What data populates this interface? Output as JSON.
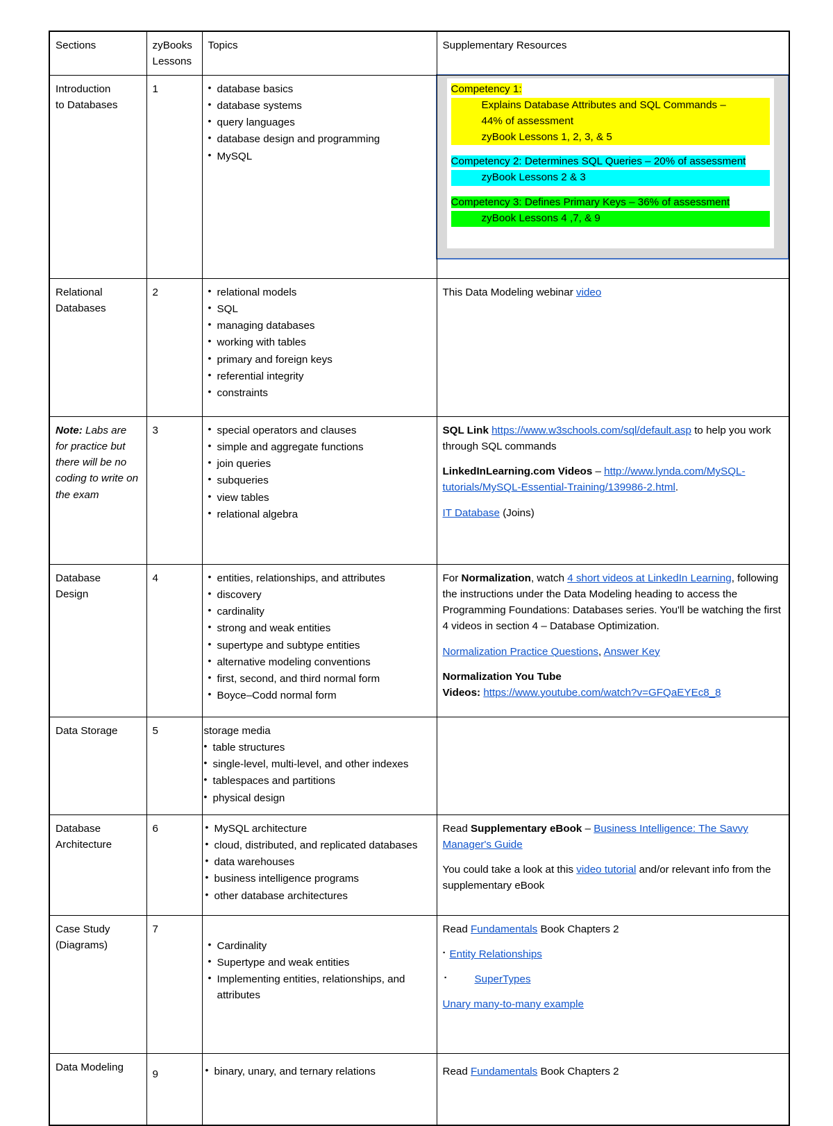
{
  "table": {
    "headers": {
      "sections": "Sections",
      "lessons_line1": "zyBooks",
      "lessons_line2": "Lessons",
      "topics": "Topics",
      "resources": "Supplementary Resources"
    },
    "rows": [
      {
        "section_line1": "Introduction",
        "section_line2": "to Databases",
        "lesson": "1",
        "topics": [
          "database basics",
          "database systems",
          "query languages",
          "database design and programming",
          "MySQL"
        ],
        "competency_box": {
          "c1_title": "Competency 1:",
          "c1_l1": "Explains Database Attributes and SQL Commands –",
          "c1_l2": "44% of assessment",
          "c1_l3": "zyBook Lessons 1, 2, 3, & 5",
          "c2_l1": "Competency 2: Determines SQL Queries – 20% of assessment",
          "c2_l2": "zyBook Lessons 2 & 3",
          "c3_l1": "Competency 3: Defines Primary Keys – 36% of assessment",
          "c3_l2": "zyBook Lessons 4 ,7, & 9",
          "colors": {
            "c1": "#ffff00",
            "c2": "#00ffff",
            "c3": "#00ff00",
            "border": "#4472c4",
            "fill": "#d9d9d9"
          }
        }
      },
      {
        "section_line1": "Relational",
        "section_line2": "Databases",
        "lesson": "2",
        "topics": [
          "relational models",
          "SQL",
          "managing databases",
          "working with tables",
          "primary and foreign keys",
          "referential integrity",
          "constraints"
        ],
        "resources": {
          "p1_pre": "This Data Modeling webinar ",
          "p1_link": "video"
        }
      },
      {
        "note_bold": "Note:",
        "note_text": " Labs are for practice but there will be no coding to write on the exam",
        "lesson": "3",
        "topics": [
          "special operators and clauses",
          "simple and aggregate functions",
          "join queries",
          "subqueries",
          "view tables",
          "relational algebra"
        ],
        "resources": {
          "p1_pre": " SQL Link ",
          "p1_link": "https://www.w3schools.com/sql/default.asp",
          "p1_post": " to help you work through SQL commands",
          "p2_bold": "LinkedInLearning.com Videos",
          "p2_dash": " – ",
          "p2_link": "http://www.lynda.com/MySQL-tutorials/MySQL-Essential-Training/139986-2.html",
          "p2_post": ".",
          "p3_link": "IT Database",
          "p3_post": "  (Joins)"
        }
      },
      {
        "section_line1": "Database",
        "section_line2": "Design",
        "lesson": "4",
        "topics": [
          "entities, relationships, and attributes",
          "discovery",
          "cardinality",
          "strong and weak entities",
          "supertype and subtype entities",
          "alternative modeling conventions",
          "first, second, and third normal form",
          "Boyce–Codd normal form"
        ],
        "resources": {
          "p1_pre": "For ",
          "p1_bold": "Normalization",
          "p1_mid": ", watch ",
          "p1_link": "4 short videos at LinkedIn Learning",
          "p1_post": ", following the instructions under the Data Modeling heading to access the Programming Foundations: Databases series.  You'll be watching the first 4 videos in section 4 – Database Optimization.",
          "p2_link1": "Normalization Practice Questions",
          "p2_sep": ", ",
          "p2_link2": "Answer Key",
          "p3_bold1": "Normalization You Tube",
          "p3_bold2": "Videos:",
          "p3_link": "https://www.youtube.com/watch?v=GFQaEYEc8_8"
        }
      },
      {
        "section_line1": "Data Storage",
        "lesson": "5",
        "topics_nobullet_first": "storage media",
        "topics": [
          "table structures",
          "single-level, multi-level, and other indexes",
          "tablespaces and partitions",
          "physical design"
        ]
      },
      {
        "section_line1": "Database",
        "section_line2": "Architecture",
        "lesson": "6",
        "topics": [
          "MySQL architecture",
          "cloud, distributed, and replicated databases",
          "data warehouses",
          "business intelligence programs",
          "other database architectures"
        ],
        "resources": {
          "p1_pre": "Read ",
          "p1_bold": "Supplementary eBook",
          "p1_dash": " – ",
          "p1_link": "Business Intelligence:  The Savvy Manager's Guide",
          "p2_pre": " You could take a look at this ",
          "p2_link": "video tutorial",
          "p2_post": " and/or relevant info from the supplementary eBook"
        }
      },
      {
        "section_line1": "Case Study",
        "section_line2": "(Diagrams)",
        "lesson": "7",
        "topics": [
          "Cardinality",
          "Supertype and weak entities",
          "Implementing entities, relationships, and attributes"
        ],
        "resources": {
          "p1_pre": " Read ",
          "p1_link": "Fundamentals",
          "p1_post": " Book Chapters 2",
          "p2_link": "Entity Relationships",
          "p3_link": "SuperTypes",
          "p4_link": "Unary many-to-many example "
        }
      },
      {
        "section_line1": "Data Modeling",
        "lesson": "9",
        "topics": [
          "binary, unary, and ternary relations"
        ],
        "resources": {
          "p1_pre": "Read ",
          "p1_link": "Fundamentals",
          "p1_post": " Book Chapters 2"
        }
      }
    ]
  }
}
